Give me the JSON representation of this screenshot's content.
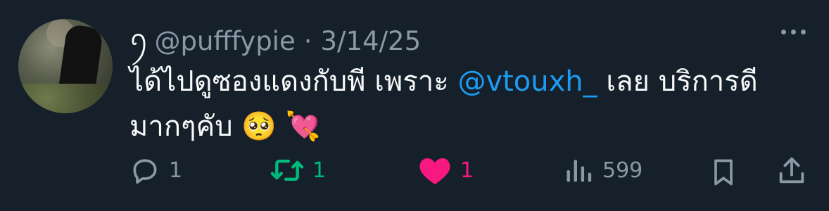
{
  "tweet": {
    "display_name": "ꪆ",
    "handle": "@pufffypie",
    "separator": "·",
    "date": "3/14/25",
    "text_before_mention": "ได้ไปดูซองแดงกับพี เพราะ ",
    "mention": "@vtouxh_",
    "text_after_mention": " เลย บริการดีมากๆคับ ",
    "emojis": "🥺 💘"
  },
  "actions": {
    "replies": "1",
    "retweets": "1",
    "likes": "1",
    "views": "599"
  },
  "colors": {
    "background": "#15202b",
    "text": "#f7f9f9",
    "muted": "#8b98a5",
    "mention": "#1d9bf0",
    "retweet": "#00ba7c",
    "like": "#f91880"
  },
  "icons": [
    "reply-icon",
    "retweet-icon",
    "heart-icon",
    "views-icon",
    "bookmark-icon",
    "share-icon",
    "more-icon"
  ]
}
